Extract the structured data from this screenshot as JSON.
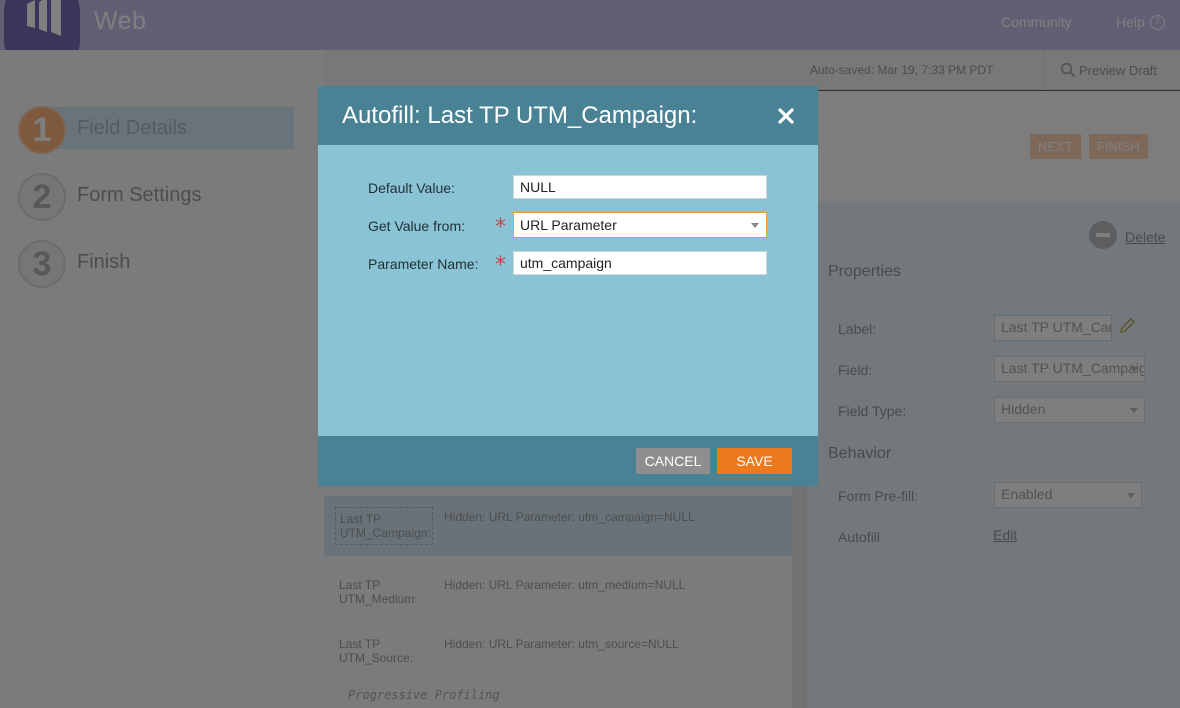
{
  "app": {
    "title": "Web"
  },
  "topnav": {
    "community": "Community",
    "help": "Help",
    "help_icon": "?"
  },
  "steps": [
    {
      "num": "1",
      "label": "Field Details"
    },
    {
      "num": "2",
      "label": "Form Settings"
    },
    {
      "num": "3",
      "label": "Finish"
    }
  ],
  "toolbar": {
    "autosaved": "Auto-saved: Mar 19, 7:33 PM PDT",
    "preview": "Preview Draft"
  },
  "header_buttons": {
    "next": "NEXT",
    "finish": "FINISH"
  },
  "form_fields": [
    {
      "label": "Last TP UTM_Campaign:",
      "desc": "Hidden: URL Parameter: utm_campaign=NULL"
    },
    {
      "label": "Last TP UTM_Medium:",
      "desc": "Hidden: URL Parameter: utm_medium=NULL"
    },
    {
      "label": "Last TP UTM_Source:",
      "desc": "Hidden: URL Parameter: utm_source=NULL"
    }
  ],
  "progressive_profiling": "Progressive Profiling",
  "properties": {
    "delete": "Delete",
    "title": "Properties",
    "label_label": "Label:",
    "label_value": "Last TP UTM_Campaign:",
    "field_label": "Field:",
    "field_value": "Last TP UTM_Campaign",
    "type_label": "Field Type:",
    "type_value": "Hidden",
    "behavior_title": "Behavior",
    "prefill_label": "Form Pre-fill:",
    "prefill_value": "Enabled",
    "autofill_label": "Autofill",
    "autofill_edit": "Edit"
  },
  "modal": {
    "title": "Autofill: Last TP UTM_Campaign:",
    "required_mark": "*",
    "default_label": "Default Value:",
    "default_value": "NULL",
    "get_label": "Get Value from:",
    "get_value": "URL Parameter",
    "param_label": "Parameter Name:",
    "param_value": "utm_campaign",
    "cancel": "CANCEL",
    "save": "SAVE"
  },
  "colors": {
    "modal_header": "#4a8295",
    "modal_body": "#8ac3d4",
    "save_button": "#ec7a1c",
    "cancel_button": "#8e8e8e",
    "required": "#b74d4d",
    "brand_purple": "#7968b2"
  }
}
